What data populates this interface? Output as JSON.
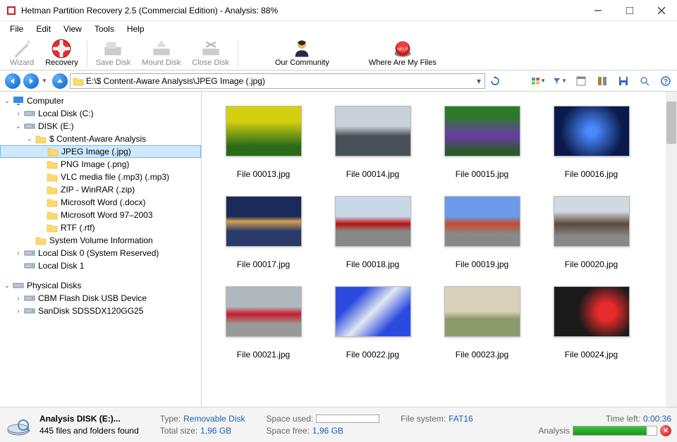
{
  "titlebar": {
    "title": "Hetman Partition Recovery 2.5 (Commercial Edition) - Analysis: 88%"
  },
  "menubar": [
    "File",
    "Edit",
    "View",
    "Tools",
    "Help"
  ],
  "toolbar": [
    {
      "label": "Wizard",
      "enabled": false,
      "icon": "wizard"
    },
    {
      "label": "Recovery",
      "enabled": true,
      "icon": "recovery"
    },
    {
      "label": "Save Disk",
      "enabled": false,
      "icon": "savedisk"
    },
    {
      "label": "Mount Disk",
      "enabled": false,
      "icon": "mountdisk"
    },
    {
      "label": "Close Disk",
      "enabled": false,
      "icon": "closedisk"
    },
    {
      "label": "Our Community",
      "enabled": true,
      "icon": "community"
    },
    {
      "label": "Where Are My Files",
      "enabled": true,
      "icon": "redbutton"
    }
  ],
  "addressbar": {
    "path": "E:\\$ Content-Aware Analysis\\JPEG Image (.jpg)"
  },
  "tree": {
    "root1": "Computer",
    "items1": [
      {
        "label": "Local Disk (C:)",
        "icon": "disk",
        "indent": 1,
        "twisty": ">"
      },
      {
        "label": "DISK (E:)",
        "icon": "disk",
        "indent": 1,
        "twisty": "v"
      },
      {
        "label": "$ Content-Aware Analysis",
        "icon": "folder",
        "indent": 2,
        "twisty": "v"
      },
      {
        "label": "JPEG Image (.jpg)",
        "icon": "folder",
        "indent": 3,
        "twisty": "",
        "selected": true
      },
      {
        "label": "PNG Image (.png)",
        "icon": "folder",
        "indent": 3,
        "twisty": ""
      },
      {
        "label": "VLC media file (.mp3) (.mp3)",
        "icon": "folder",
        "indent": 3,
        "twisty": ""
      },
      {
        "label": "ZIP - WinRAR (.zip)",
        "icon": "folder",
        "indent": 3,
        "twisty": ""
      },
      {
        "label": "Microsoft Word (.docx)",
        "icon": "folder",
        "indent": 3,
        "twisty": ""
      },
      {
        "label": "Microsoft Word 97–2003",
        "icon": "folder",
        "indent": 3,
        "twisty": ""
      },
      {
        "label": "RTF (.rtf)",
        "icon": "folder",
        "indent": 3,
        "twisty": ""
      },
      {
        "label": "System Volume Information",
        "icon": "folder",
        "indent": 2,
        "twisty": ""
      },
      {
        "label": "Local Disk 0 (System Reserved)",
        "icon": "disk",
        "indent": 1,
        "twisty": ">"
      },
      {
        "label": "Local Disk 1",
        "icon": "disk",
        "indent": 1,
        "twisty": ""
      }
    ],
    "root2": "Physical Disks",
    "items2": [
      {
        "label": "CBM Flash Disk USB Device",
        "icon": "disk",
        "indent": 1,
        "twisty": ">"
      },
      {
        "label": "SanDisk SDSSDX120GG25",
        "icon": "disk",
        "indent": 1,
        "twisty": ">"
      }
    ]
  },
  "files": [
    {
      "name": "File 00013.jpg",
      "cls": "t13"
    },
    {
      "name": "File 00014.jpg",
      "cls": "t14"
    },
    {
      "name": "File 00015.jpg",
      "cls": "t15"
    },
    {
      "name": "File 00016.jpg",
      "cls": "t16"
    },
    {
      "name": "File 00017.jpg",
      "cls": "t17"
    },
    {
      "name": "File 00018.jpg",
      "cls": "t18"
    },
    {
      "name": "File 00019.jpg",
      "cls": "t19"
    },
    {
      "name": "File 00020.jpg",
      "cls": "t20"
    },
    {
      "name": "File 00021.jpg",
      "cls": "t21"
    },
    {
      "name": "File 00022.jpg",
      "cls": "t22"
    },
    {
      "name": "File 00023.jpg",
      "cls": "t23"
    },
    {
      "name": "File 00024.jpg",
      "cls": "t24"
    }
  ],
  "status": {
    "title": "Analysis DISK (E:)...",
    "count": "445 files and folders found",
    "type_lbl": "Type:",
    "type_val": "Removable Disk",
    "size_lbl": "Total size:",
    "size_val": "1,96 GB",
    "used_lbl": "Space used:",
    "free_lbl": "Space free:",
    "free_val": "1,96 GB",
    "fs_lbl": "File system:",
    "fs_val": "FAT16",
    "time_lbl": "Time left:",
    "time_val": "0:00:36",
    "analysis_lbl": "Analysis",
    "progress_pct": 88
  }
}
